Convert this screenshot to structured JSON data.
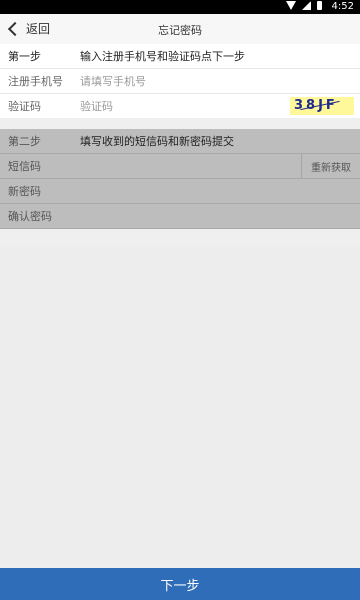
{
  "statusbar": {
    "time": "4:52"
  },
  "header": {
    "back_label": "返回",
    "title": "忘记密码"
  },
  "step1": {
    "step_label": "第一步",
    "instruction": "输入注册手机号和验证码点下一步",
    "phone_label": "注册手机号",
    "phone_placeholder": "请填写手机号",
    "code_label": "验证码",
    "code_placeholder": "验证码",
    "captcha_text": "38JF"
  },
  "step2": {
    "step_label": "第二步",
    "instruction": "填写收到的短信码和新密码提交",
    "sms_label": "短信码",
    "resend_label": "重新获取",
    "new_password_label": "新密码",
    "confirm_password_label": "确认密码"
  },
  "footer": {
    "next_label": "下一步"
  }
}
